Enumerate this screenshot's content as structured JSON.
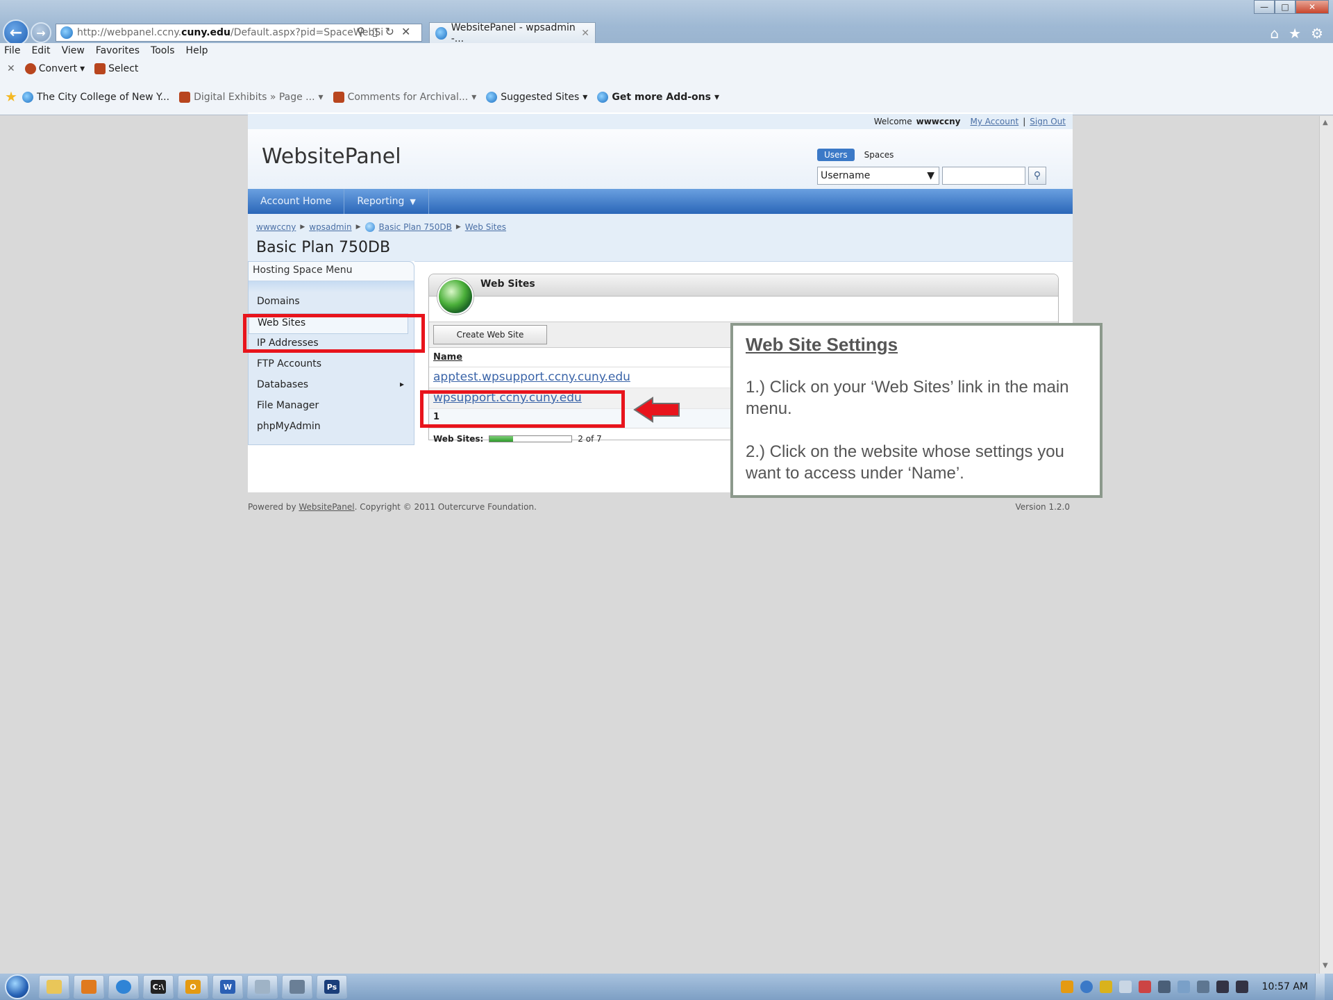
{
  "browser": {
    "url_prefix": "http://webpanel.ccny.",
    "url_domain": "cuny.edu",
    "url_path": "/Default.aspx?pid=SpaceWebSi",
    "tab_title": "WebsitePanel - wpsadmin -...",
    "menu": [
      "File",
      "Edit",
      "View",
      "Favorites",
      "Tools",
      "Help"
    ],
    "command_bar": {
      "convert_label": "Convert",
      "select_label": "Select"
    },
    "favorites": [
      {
        "label": "The City College of New Y...",
        "icon": "ie-page-icon"
      },
      {
        "label": "Digital Exhibits » Page ...",
        "icon": "favorite-site-icon"
      },
      {
        "label": "Comments for Archival...",
        "icon": "favorite-site-icon"
      },
      {
        "label": "Suggested Sites",
        "icon": "ie-icon"
      },
      {
        "label": "Get more Add-ons",
        "icon": "ie-page-icon"
      }
    ]
  },
  "panel": {
    "welcome_text": "Welcome",
    "username": "wwwccny",
    "my_account_label": "My Account",
    "sign_out_label": "Sign Out",
    "logo": "WebsitePanel",
    "search": {
      "tab_users": "Users",
      "tab_spaces": "Spaces",
      "select_value": "Username",
      "input_value": ""
    },
    "nav": {
      "account_home": "Account Home",
      "reporting": "Reporting"
    },
    "breadcrumb": [
      "wwwccny",
      "wpsadmin",
      "Basic Plan 750DB",
      "Web Sites"
    ],
    "space_title": "Basic Plan 750DB",
    "side_menu": {
      "title": "Hosting Space Menu",
      "items": [
        "Domains",
        "Web Sites",
        "IP Addresses",
        "FTP Accounts",
        "Databases",
        "File Manager",
        "phpMyAdmin"
      ]
    },
    "web_sites": {
      "title": "Web Sites",
      "create_button": "Create Web Site",
      "column_name": "Name",
      "rows": [
        "apptest.wpsupport.ccny.cuny.edu",
        "wpsupport.ccny.cuny.edu"
      ],
      "page_number": "1",
      "quota_label": "Web Sites:",
      "quota_text": "2 of 7",
      "quota_used": 2,
      "quota_total": 7
    },
    "footer": {
      "powered_prefix": "Powered by",
      "powered_link": "WebsitePanel",
      "copyright": ". Copyright © 2011 Outercurve Foundation.",
      "version": "Version 1.2.0"
    }
  },
  "callout": {
    "title": "Web Site Settings",
    "step1": "1.) Click on your ‘Web Sites’ link in the main menu.",
    "step2": "2.) Click on the website whose settings you want to access under ‘Name’."
  },
  "taskbar": {
    "clock": "10:57 AM"
  },
  "colors": {
    "highlight": "#e8141c",
    "nav_blue": "#2a66b8",
    "callout_border": "#8c998c"
  }
}
